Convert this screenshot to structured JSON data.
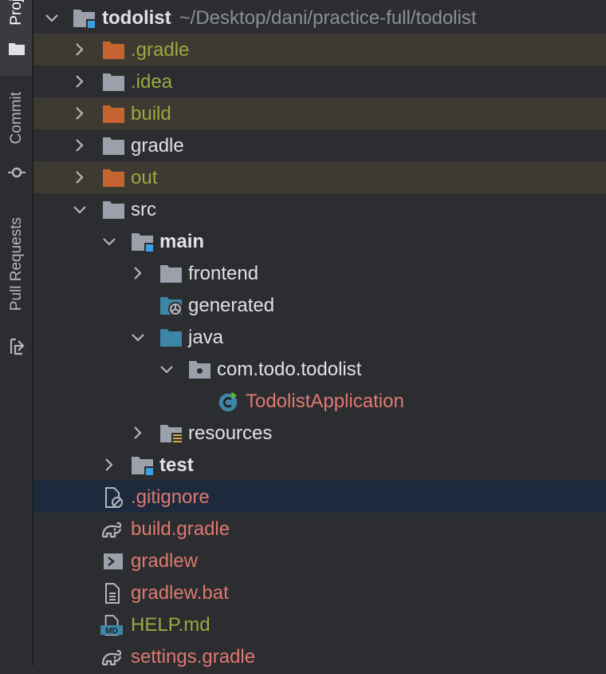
{
  "sidebar": {
    "tabs": [
      {
        "label": "Proj",
        "icon": "folder-icon"
      },
      {
        "label": "Commit",
        "icon": "commit-icon"
      },
      {
        "label": "Pull Requests",
        "icon": "pull-request-icon"
      }
    ]
  },
  "tree": {
    "root": {
      "label": "todolist",
      "path": "~/Desktop/dani/practice-full/todolist"
    },
    "items": [
      {
        "label": ".gradle",
        "icon": "folder-excluded-icon"
      },
      {
        "label": ".idea",
        "icon": "folder-icon"
      },
      {
        "label": "build",
        "icon": "folder-excluded-icon"
      },
      {
        "label": "gradle",
        "icon": "folder-icon"
      },
      {
        "label": "out",
        "icon": "folder-excluded-icon"
      },
      {
        "label": "src",
        "icon": "folder-icon"
      },
      {
        "label": "main",
        "icon": "module-folder-icon"
      },
      {
        "label": "frontend",
        "icon": "folder-icon"
      },
      {
        "label": "generated",
        "icon": "generated-sources-folder-icon"
      },
      {
        "label": "java",
        "icon": "source-folder-icon"
      },
      {
        "label": "com.todo.todolist",
        "icon": "package-icon"
      },
      {
        "label": "TodolistApplication",
        "icon": "java-class-icon"
      },
      {
        "label": "resources",
        "icon": "resources-folder-icon"
      },
      {
        "label": "test",
        "icon": "module-folder-icon"
      },
      {
        "label": ".gitignore",
        "icon": "ignore-file-icon"
      },
      {
        "label": "build.gradle",
        "icon": "gradle-icon"
      },
      {
        "label": "gradlew",
        "icon": "shell-script-icon"
      },
      {
        "label": "gradlew.bat",
        "icon": "text-file-icon"
      },
      {
        "label": "HELP.md",
        "icon": "markdown-file-icon"
      },
      {
        "label": "settings.gradle",
        "icon": "gradle-icon"
      }
    ]
  },
  "colors": {
    "background": "#2b2d30",
    "excluded_row": "#3d3a32",
    "selected_row": "#1d2a3e",
    "ignored_text": "#a0a73f",
    "unversioned_text": "#e0786f",
    "folder_gray": "#9aa1ab",
    "folder_excluded": "#c5642f",
    "source_blue": "#3e86a8",
    "module_blue": "#3d9ee0"
  },
  "badges": {
    "markdown": "MD"
  }
}
